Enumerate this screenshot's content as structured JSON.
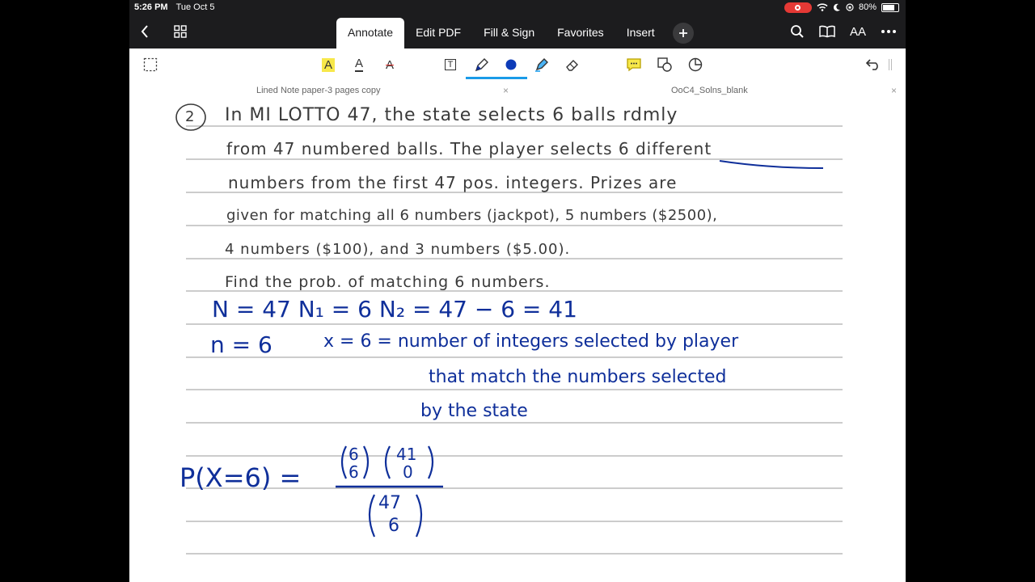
{
  "status": {
    "time": "5:26 PM",
    "date": "Tue Oct 5",
    "battery": "80%"
  },
  "nav": {
    "tabs": [
      {
        "label": "Annotate"
      },
      {
        "label": "Edit PDF"
      },
      {
        "label": "Fill & Sign"
      },
      {
        "label": "Favorites"
      },
      {
        "label": "Insert"
      }
    ],
    "font_size_glyph": "AA"
  },
  "toolbar": {
    "highlight_glyph": "A",
    "underline_glyph": "A",
    "strike_glyph": "A",
    "textbox_glyph": "T"
  },
  "doc_tabs": [
    {
      "label": "Lined Note paper-3 pages copy",
      "close": "×"
    },
    {
      "label": "OoC4_Solns_blank",
      "close": "×"
    }
  ],
  "note": {
    "problem_number": "2",
    "lines": [
      "In MI LOTTO 47, the state selects 6 balls rdmly",
      "from 47 numbered balls. The player selects 6 different",
      "numbers from the first 47 pos. integers. Prizes are",
      "given for matching all 6 numbers (jackpot), 5 numbers ($2500),",
      "4 numbers ($100), and 3 numbers ($5.00).",
      "Find the prob. of matching 6 numbers."
    ],
    "work": {
      "line1": "N = 47   N₁ = 6   N₂ = 47 − 6 = 41",
      "line2a": "n = 6",
      "line2b": "x = 6 = number of integers selected by player",
      "line3": "that match the numbers selected",
      "line4": "by the state",
      "prob_lhs": "P(X=6) =",
      "num1_top": "6",
      "num1_bot": "6",
      "num2_top": "41",
      "num2_bot": "0",
      "den_top": "47",
      "den_bot": "6"
    }
  }
}
